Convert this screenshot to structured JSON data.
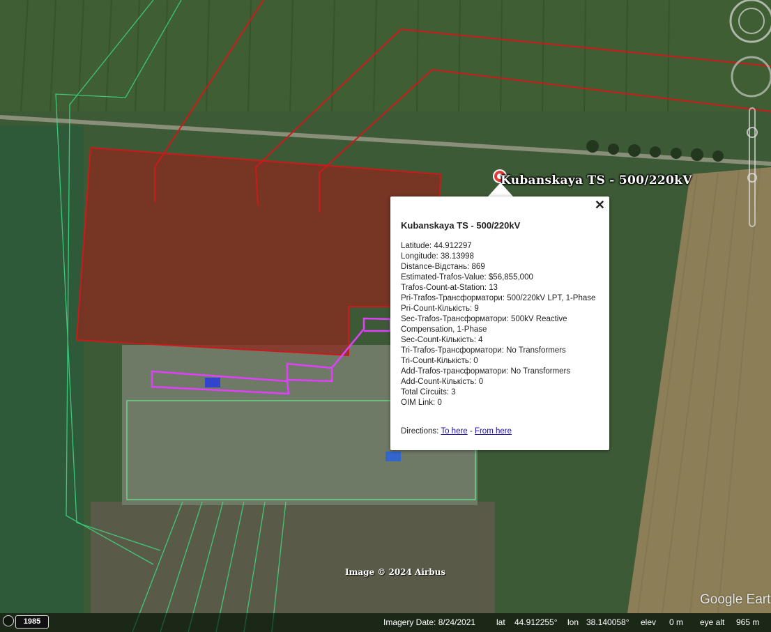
{
  "app": {
    "name": "Google Earth"
  },
  "placemark": {
    "label": "Kubanskaya TS - 500/220kV"
  },
  "balloon": {
    "title": "Kubanskaya TS - 500/220kV",
    "close_icon": "close-icon",
    "fields": [
      "Latitude: 44.912297",
      "Longitude: 38.13998",
      "Distance-Відстань: 869",
      "Estimated-Trafos-Value: $56,855,000",
      "Trafos-Count-at-Station: 13",
      "Pri-Trafos-Трансформатори: 500/220kV LPT, 1-Phase",
      "Pri-Count-Кількість: 9",
      "Sec-Trafos-Трансформатори: 500kV Reactive Compensation, 1-Phase",
      "Sec-Count-Кількість: 4",
      "Tri-Trafos-Трансформатори: No Transformers",
      "Tri-Count-Кількість: 0",
      "Add-Trafos-трансформатори: No Transformers",
      "Add-Count-Кількість: 0",
      "Total Circuits: 3",
      "OIM Link: 0"
    ],
    "directions_label": "Directions:",
    "to_here": "To here",
    "separator": "-",
    "from_here": "From here"
  },
  "map": {
    "copyright": "Image © 2024 Airbus",
    "logo": "Google Earth",
    "colors": {
      "substation_fill": "#8b2a1f",
      "powerline_red": "#cc1a1a",
      "powerline_green": "#3ddc84",
      "transformer_outline": "#e040fb"
    }
  },
  "status_bar": {
    "year": "1985",
    "imagery_date": "Imagery Date: 8/24/2021",
    "lat_label": "lat",
    "lat_value": "44.912255°",
    "lon_label": "lon",
    "lon_value": "38.140058°",
    "elev_label": "elev",
    "elev_value": "0 m",
    "eye_alt_label": "eye alt",
    "eye_alt_value": "965 m"
  }
}
